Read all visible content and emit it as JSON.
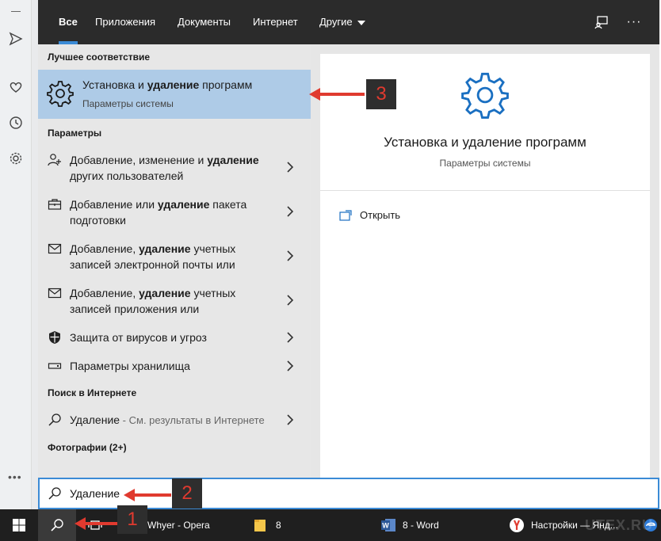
{
  "tabs": [
    {
      "label": "Все"
    },
    {
      "label": "Приложения"
    },
    {
      "label": "Документы"
    },
    {
      "label": "Интернет"
    },
    {
      "label": "Другие"
    }
  ],
  "best_match": {
    "header": "Лучшее соответствие",
    "title_pre": "Установка и ",
    "title_bold": "удаление",
    "title_post": " программ",
    "subtitle": "Параметры системы"
  },
  "settings": {
    "header": "Параметры",
    "items": [
      {
        "pre": "Добавление, изменение и ",
        "bold": "удаление",
        "post": " других пользователей",
        "icon": "person-add-icon"
      },
      {
        "pre": "Добавление или ",
        "bold": "удаление",
        "post": " пакета подготовки",
        "icon": "briefcase-icon"
      },
      {
        "pre": "Добавление, ",
        "bold": "удаление",
        "post": " учетных записей электронной почты или",
        "icon": "mail-icon"
      },
      {
        "pre": "Добавление, ",
        "bold": "удаление",
        "post": " учетных записей приложения или",
        "icon": "mail-icon"
      },
      {
        "pre": "Защита от вирусов и угроз",
        "bold": "",
        "post": "",
        "icon": "shield-icon"
      },
      {
        "pre": "Параметры хранилища",
        "bold": "",
        "post": "",
        "icon": "storage-icon"
      }
    ]
  },
  "web": {
    "header": "Поиск в Интернете",
    "query": "Удаление",
    "hint": " - См. результаты в Интернете"
  },
  "photos": {
    "header": "Фотографии (2+)"
  },
  "preview": {
    "title": "Установка и удаление программ",
    "subtitle": "Параметры системы",
    "open_label": "Открыть"
  },
  "search": {
    "value": "Удаление"
  },
  "taskbar": {
    "opera": "Whyer - Opera",
    "folder": "8",
    "word": "8 - Word",
    "yandex": "Настройки — Янд...",
    "watermark": "UTEX.RU"
  },
  "annotations": [
    "1",
    "2",
    "3"
  ],
  "colors": {
    "accent": "#3b8bd6",
    "highlight": "#aecbe7",
    "arrow": "#e03a2f"
  }
}
